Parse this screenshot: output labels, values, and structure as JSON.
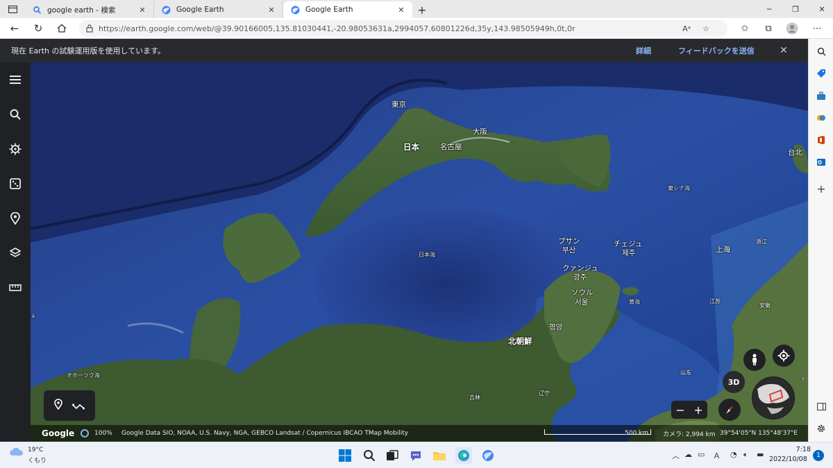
{
  "browser": {
    "tabs": [
      {
        "label": "google earth - 検索",
        "active": false
      },
      {
        "label": "Google Earth",
        "active": false
      },
      {
        "label": "Google Earth",
        "active": true
      }
    ],
    "url": "https://earth.google.com/web/@39.90166005,135.81030441,-20.98053631a,2994057.60801226d,35y,143.98505949h,0t,0r"
  },
  "banner": {
    "text": "現在 Earth の試験運用版を使用しています。",
    "more": "詳細",
    "feedback": "フィードバックを送信"
  },
  "map": {
    "labels": {
      "tokyo": "東京",
      "japan": "日本",
      "nagoya": "名古屋",
      "osaka": "大阪",
      "taipei": "台北",
      "east_china_sea": "東シナ海",
      "busan_kana": "プサン",
      "busan_hangul": "부산",
      "jeju_kana": "チェジュ",
      "jeju_hangul": "제주",
      "shanghai": "上海",
      "zhejiang": "浙江",
      "gwangju_kana": "クァンジュ",
      "gwangju_hangul": "광주",
      "sea_of_japan": "日本海",
      "seoul_kana": "ソウル",
      "seoul_hangul": "서울",
      "yellow_sea": "黄海",
      "jiangsu": "江苏",
      "anhui": "安徽",
      "pyongyang": "평양",
      "north_korea": "北朝鮮",
      "okhotsk": "オホーツク海",
      "shandong": "山东",
      "liaoning": "辽宁",
      "jilin": "吉林",
      "edge_left": "ﾑ",
      "edge_right": "ﾅ"
    }
  },
  "attribution": {
    "google": "Google",
    "percent": "100%",
    "data": "Google   Data SIO, NOAA, U.S. Navy, NGA, GEBCO   Landsat / Copernicus   IBCAO   TMap Mobility",
    "scale": "500 km",
    "camera": "カメラ: 2,994 km",
    "coords": "39°54'05\"N 135°48'37\"E"
  },
  "controls": {
    "three_d": "3D",
    "zoom_out": "−",
    "zoom_in": "+"
  },
  "taskbar": {
    "temp": "19°C",
    "condition": "くもり",
    "time": "7:18",
    "date": "2022/10/08",
    "notifications": "1"
  },
  "colors": {
    "banner_link": "#8ab4f8",
    "banner_bg": "#292a2d",
    "toolbar_bg": "#202124",
    "ocean": "#1f3d8a"
  }
}
